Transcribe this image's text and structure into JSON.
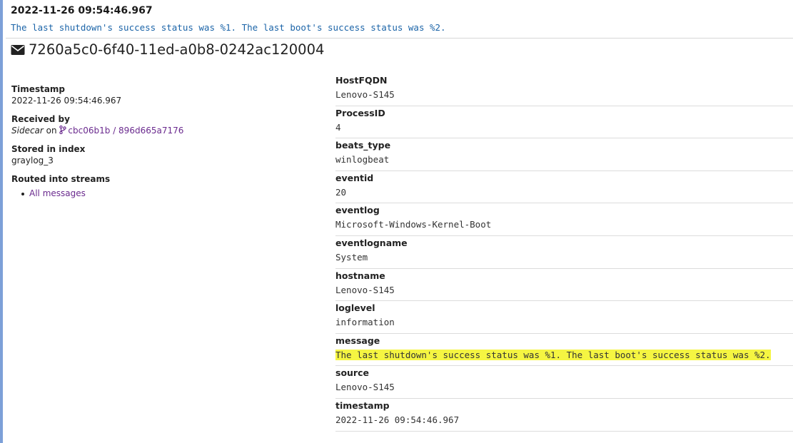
{
  "header": {
    "timestamp": "2022-11-26 09:54:46.967",
    "message": "The last shutdown's success status was %1. The last boot's success status was %2."
  },
  "message_id": "7260a5c0-6f40-11ed-a0b8-0242ac120004",
  "meta": {
    "timestamp_label": "Timestamp",
    "timestamp_value": "2022-11-26 09:54:46.967",
    "received_by_label": "Received by",
    "received_by_source": "Sidecar",
    "received_by_on": " on ",
    "received_by_node": "cbc06b1b / 896d665a7176",
    "stored_label": "Stored in index",
    "stored_value": "graylog_3",
    "routed_label": "Routed into streams",
    "streams": [
      "All messages"
    ]
  },
  "fields": [
    {
      "name": "HostFQDN",
      "value": "Lenovo-S145"
    },
    {
      "name": "ProcessID",
      "value": "4"
    },
    {
      "name": "beats_type",
      "value": "winlogbeat"
    },
    {
      "name": "eventid",
      "value": "20"
    },
    {
      "name": "eventlog",
      "value": "Microsoft-Windows-Kernel-Boot"
    },
    {
      "name": "eventlogname",
      "value": "System"
    },
    {
      "name": "hostname",
      "value": "Lenovo-S145"
    },
    {
      "name": "loglevel",
      "value": "information"
    },
    {
      "name": "message",
      "value": "The last shutdown's success status was %1. The last boot's success status was %2.",
      "highlighted": true
    },
    {
      "name": "source",
      "value": "Lenovo-S145"
    },
    {
      "name": "timestamp",
      "value": "2022-11-26 09:54:46.967"
    }
  ],
  "colors": {
    "accent_border": "#7da0d8",
    "link": "#6a2a8e",
    "message_text": "#1b64a8",
    "highlight": "#f5f542"
  },
  "icons": {
    "message_id": "envelope-icon",
    "node": "code-branch-icon"
  }
}
